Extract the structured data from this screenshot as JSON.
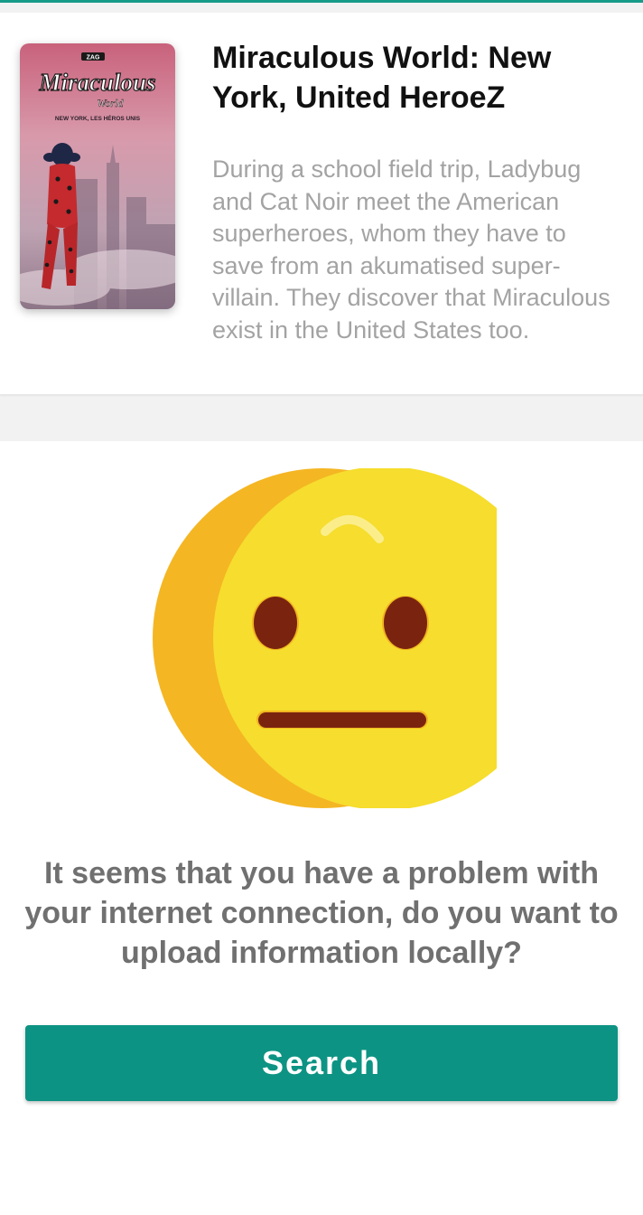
{
  "movie": {
    "title": "Miraculous World: New York, United HeroeZ",
    "description": "During a school field trip, Ladybug and Cat Noir meet the American superheroes, whom they have to save from an akumatised super-villain. They discover that Miraculous exist in the United States too.",
    "poster": {
      "studio_badge": "ZAG",
      "logo_text": "Miraculous",
      "logo_subtext": "World",
      "tagline": "NEW YORK, LES HÉROS UNIS"
    }
  },
  "offline": {
    "emoji_icon": "neutral-face-icon",
    "message": "It seems that you have a problem with your internet connection, do you want to upload information locally?",
    "button_label": "Search"
  },
  "colors": {
    "accent": "#0d9383",
    "emoji_yellow": "#f6dd2e",
    "emoji_shadow": "#f4b623",
    "emoji_features": "#7a2410",
    "message_text": "#707070",
    "description_text": "#a3a3a3"
  }
}
